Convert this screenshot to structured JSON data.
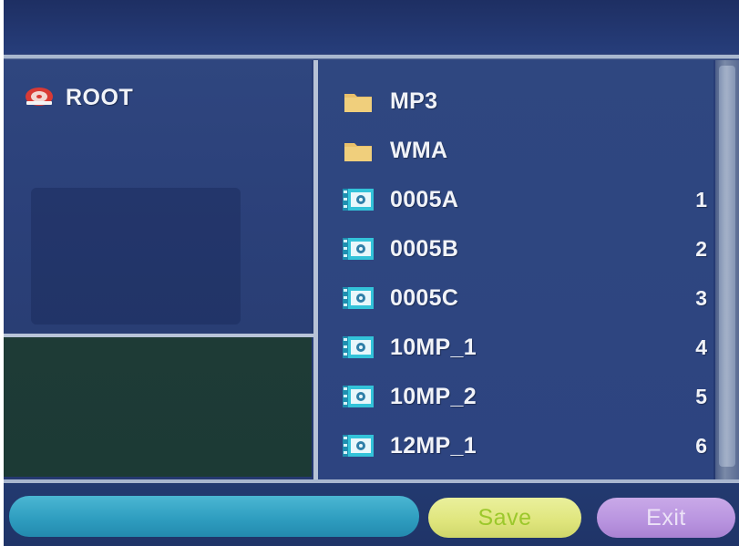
{
  "tree": {
    "root_label": "ROOT",
    "root_icon": "disc-icon"
  },
  "files": {
    "items": [
      {
        "name": "MP3",
        "type": "folder",
        "index": ""
      },
      {
        "name": "WMA",
        "type": "folder",
        "index": ""
      },
      {
        "name": "0005A",
        "type": "image",
        "index": "1"
      },
      {
        "name": "0005B",
        "type": "image",
        "index": "2"
      },
      {
        "name": "0005C",
        "type": "image",
        "index": "3"
      },
      {
        "name": "10MP_1",
        "type": "image",
        "index": "4"
      },
      {
        "name": "10MP_2",
        "type": "image",
        "index": "5"
      },
      {
        "name": "12MP_1",
        "type": "image",
        "index": "6"
      }
    ]
  },
  "footer": {
    "save_label": "Save",
    "exit_label": "Exit"
  },
  "colors": {
    "background": "#2d4480",
    "folder": "#e9c06a",
    "image_icon": "#33c3d9",
    "save_button": "#dfe57c",
    "save_text": "#9cc82c",
    "exit_button": "#b893df",
    "status_bar": "#2f9ec0"
  }
}
